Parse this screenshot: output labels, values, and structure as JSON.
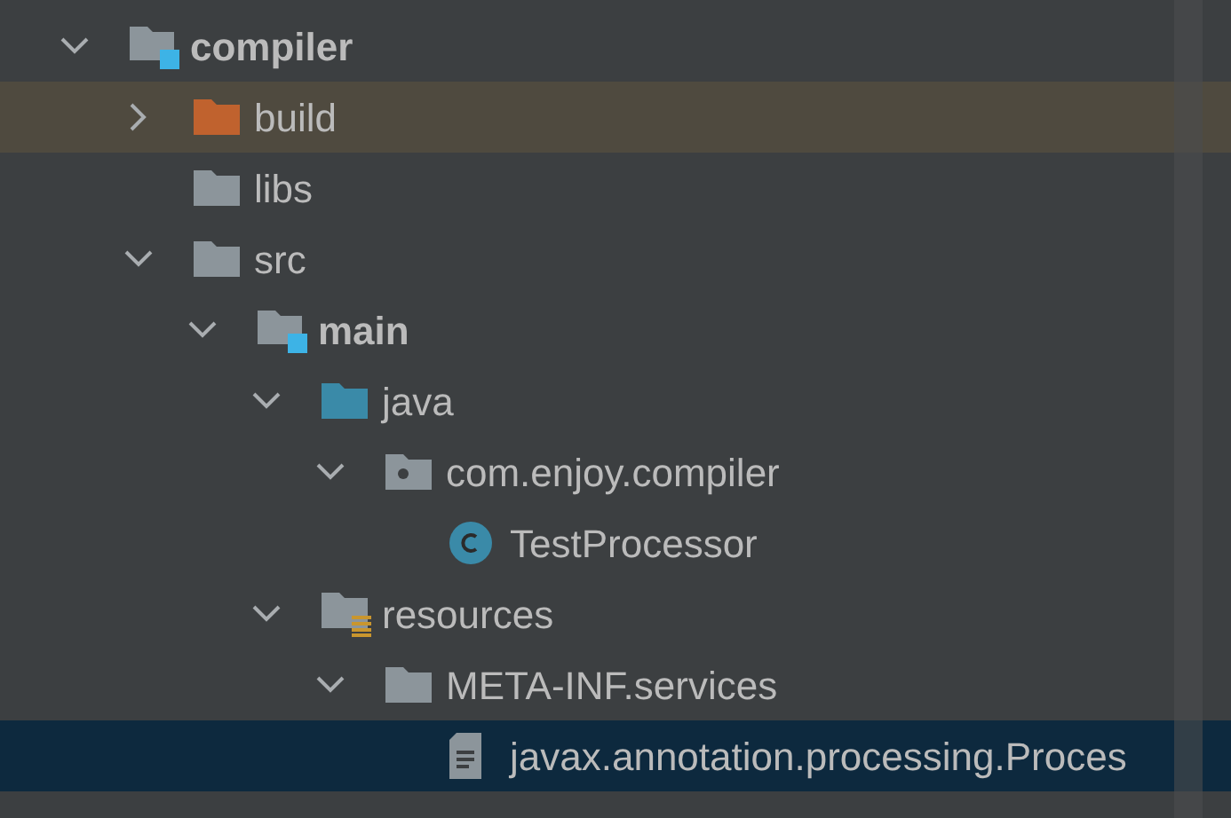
{
  "tree": [
    {
      "label": "compiler",
      "kind": "module",
      "expanded": true,
      "selected": false,
      "highlighted": false,
      "children": [
        {
          "label": "build",
          "kind": "excluded",
          "expanded": false,
          "selected": false,
          "highlighted": true
        },
        {
          "label": "libs",
          "kind": "folder",
          "selected": false,
          "highlighted": false
        },
        {
          "label": "src",
          "kind": "folder",
          "expanded": true,
          "selected": false,
          "highlighted": false,
          "children": [
            {
              "label": "main",
              "kind": "module",
              "expanded": true,
              "selected": false,
              "highlighted": false,
              "children": [
                {
                  "label": "java",
                  "kind": "source",
                  "expanded": true,
                  "selected": false,
                  "highlighted": false,
                  "children": [
                    {
                      "label": "com.enjoy.compiler",
                      "kind": "package",
                      "expanded": true,
                      "selected": false,
                      "highlighted": false,
                      "children": [
                        {
                          "label": "TestProcessor",
                          "kind": "class",
                          "selected": false,
                          "highlighted": false
                        }
                      ]
                    }
                  ]
                },
                {
                  "label": "resources",
                  "kind": "resources",
                  "expanded": true,
                  "selected": false,
                  "highlighted": false,
                  "children": [
                    {
                      "label": "META-INF.services",
                      "kind": "folder",
                      "expanded": true,
                      "selected": false,
                      "highlighted": false,
                      "children": [
                        {
                          "label": "javax.annotation.processing.Proces",
                          "kind": "file",
                          "selected": true,
                          "highlighted": false
                        }
                      ]
                    }
                  ]
                }
              ]
            }
          ]
        }
      ]
    }
  ]
}
